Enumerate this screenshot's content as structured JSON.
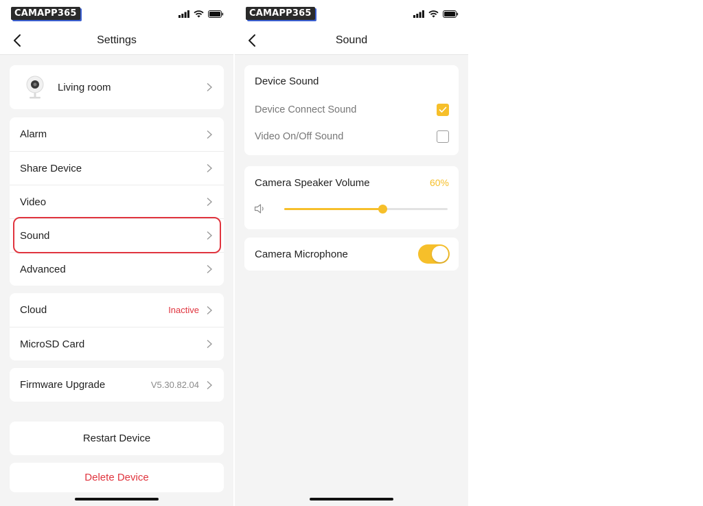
{
  "brand": "CAMAPP365",
  "colors": {
    "accent": "#f6bf2a",
    "danger": "#e0343e",
    "highlight": "#e0343e"
  },
  "settings_screen": {
    "title": "Settings",
    "device": {
      "name": "Living room",
      "icon": "webcam-icon"
    },
    "group1": [
      {
        "label": "Alarm"
      },
      {
        "label": "Share Device"
      },
      {
        "label": "Video"
      },
      {
        "label": "Sound"
      },
      {
        "label": "Advanced"
      }
    ],
    "group2": [
      {
        "label": "Cloud",
        "value": "Inactive"
      },
      {
        "label": "MicroSD Card"
      }
    ],
    "firmware": {
      "label": "Firmware Upgrade",
      "value": "V5.30.82.04"
    },
    "restart_label": "Restart Device",
    "delete_label": "Delete Device"
  },
  "sound_screen": {
    "title": "Sound",
    "device_sound": {
      "title": "Device Sound",
      "options": [
        {
          "label": "Device Connect Sound",
          "checked": true
        },
        {
          "label": "Video On/Off Sound",
          "checked": false
        }
      ]
    },
    "speaker_volume": {
      "label": "Camera Speaker Volume",
      "value_text": "60%",
      "level_percent": 60
    },
    "microphone": {
      "label": "Camera Microphone",
      "enabled": true
    }
  }
}
